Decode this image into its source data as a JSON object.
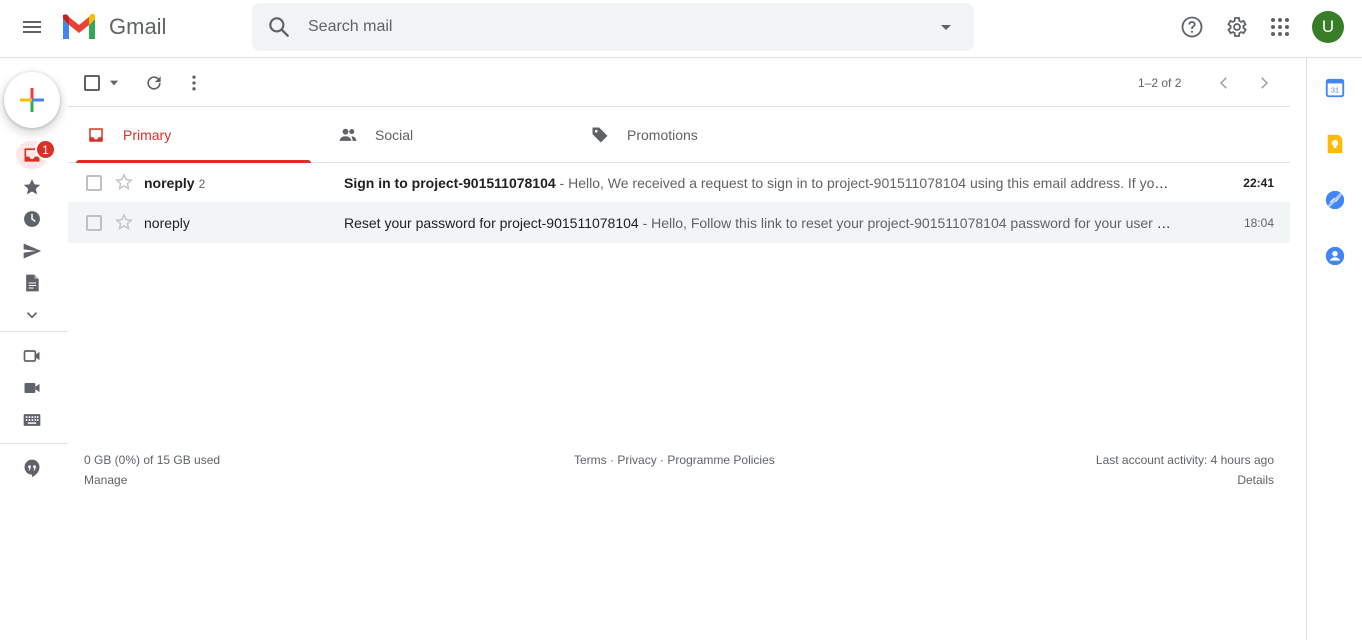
{
  "app": {
    "name": "Gmail"
  },
  "search": {
    "placeholder": "Search mail"
  },
  "header": {
    "avatar_letter": "U"
  },
  "rail": {
    "inbox_badge": "1"
  },
  "toolbar": {
    "pagination": "1–2 of 2"
  },
  "tabs": [
    {
      "label": "Primary",
      "icon": "inbox-icon",
      "active": true
    },
    {
      "label": "Social",
      "icon": "people-icon",
      "active": false
    },
    {
      "label": "Promotions",
      "icon": "tag-icon",
      "active": false
    }
  ],
  "emails": [
    {
      "sender": "noreply",
      "count": "2",
      "subject": "Sign in to project-901511078104",
      "snippet": " - Hello, We received a request to sign in to project-901511078104 using this email address. If you did not request this link, you can safely ignore this email.",
      "time": "22:41",
      "unread": true
    },
    {
      "sender": "noreply",
      "count": "",
      "subject": "Reset your password for project-901511078104",
      "snippet": " - Hello, Follow this link to reset your project-901511078104 password for your user account.",
      "time": "18:04",
      "unread": false
    }
  ],
  "footer": {
    "storage": "0 GB (0%) of 15 GB used",
    "manage": "Manage",
    "terms": "Terms",
    "privacy": "Privacy",
    "policies": "Programme Policies",
    "activity": "Last account activity: 4 hours ago",
    "details": "Details"
  },
  "colors": {
    "accent": "#d93025",
    "avatar": "#3a7d28"
  }
}
